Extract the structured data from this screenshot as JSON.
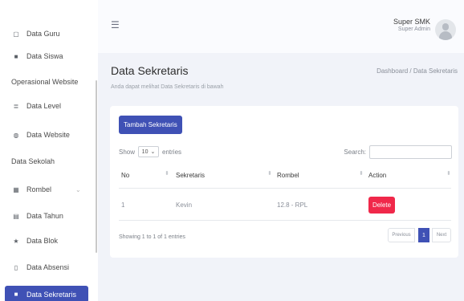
{
  "sidebar": {
    "items": [
      {
        "label": "Data Guru",
        "icon": "document-icon"
      },
      {
        "label": "Data Siswa",
        "icon": "users-icon"
      },
      {
        "label": "Data Level",
        "icon": "database-icon"
      },
      {
        "label": "Data Website",
        "icon": "globe-icon"
      },
      {
        "label": "Rombel",
        "icon": "grid-icon"
      },
      {
        "label": "Data Tahun",
        "icon": "calendar-icon"
      },
      {
        "label": "Data Blok",
        "icon": "star-icon"
      },
      {
        "label": "Data Absensi",
        "icon": "clipboard-icon"
      },
      {
        "label": "Data Sekretaris",
        "icon": "users-icon",
        "active": true
      }
    ],
    "sections": [
      "Operasional Website",
      "Data Sekolah"
    ]
  },
  "topbar": {
    "user_name": "Super SMK",
    "user_role": "Super Admin"
  },
  "page": {
    "title": "Data Sekretaris",
    "subtitle": "Anda dapat melihat Data Sekretaris di bawah",
    "breadcrumb": "Dashboard / Data Sekretaris"
  },
  "card": {
    "add_button": "Tambah Sekretaris",
    "show_label": "Show",
    "entries_value": "10",
    "entries_label": "entries",
    "search_label": "Search:",
    "columns": [
      "No",
      "Sekretaris",
      "Rombel",
      "Action"
    ],
    "rows": [
      {
        "no": "1",
        "sekretaris": "Kevin",
        "rombel": "12.8 - RPL",
        "action": "Delete"
      }
    ],
    "info": "Showing 1 to 1 of 1 entries",
    "pagination": {
      "previous": "Previous",
      "current": "1",
      "next": "Next"
    }
  },
  "colors": {
    "accent": "#3f51b5",
    "danger": "#f0284a",
    "background": "#f1f3f9"
  }
}
